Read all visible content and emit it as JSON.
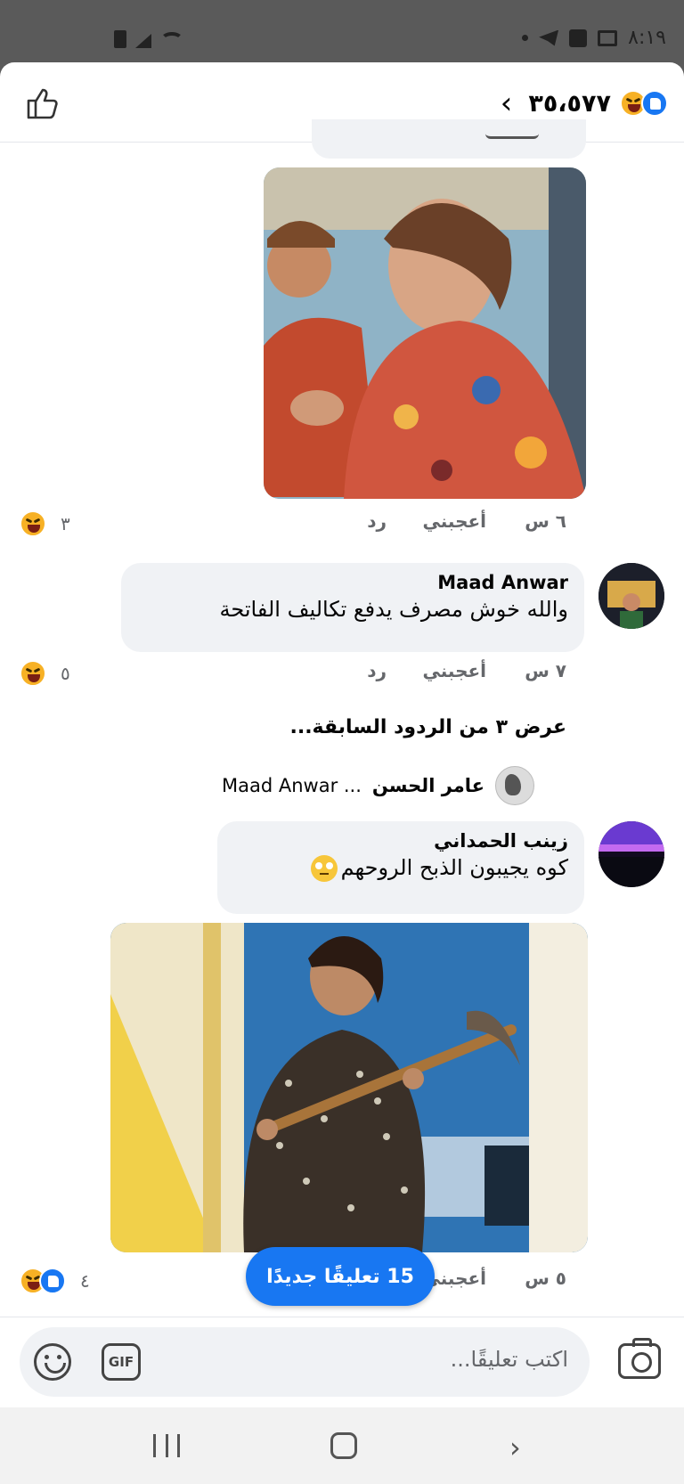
{
  "status_bar": {
    "time": "٨:١٩"
  },
  "header": {
    "reaction_count": "٣٥،٥٧٧",
    "reaction_icons": [
      "like-reaction-icon",
      "haha-reaction-icon"
    ],
    "back_icon": "chevron-left-icon",
    "like_icon": "thumbs-up-outline-icon"
  },
  "comments": [
    {
      "type": "image-reply",
      "time": "٦ س",
      "like_label": "أعجبني",
      "reply_label": "رد",
      "reaction_count": "٣"
    },
    {
      "author": "Maad Anwar",
      "text": "والله خوش مصرف يدفع تكاليف الفاتحة",
      "time": "٧ س",
      "like_label": "أعجبني",
      "reply_label": "رد",
      "reaction_count": "٥"
    },
    {
      "author": "زينب الحمداني",
      "text": "كوه يجيبون الذبح الروحهم",
      "time": "٥ س",
      "like_label": "أعجبني",
      "reaction_count": "٤"
    }
  ],
  "view_previous": "عرض ٣ من الردود السابقة...",
  "reply_preview": {
    "author": "عامر الحسن",
    "text": "Maad Anwar ..."
  },
  "new_comments_pill": "15 تعليقًا جديدًا",
  "composer": {
    "placeholder": "اكتب تعليقًا...",
    "gif_label": "GIF"
  },
  "colors": {
    "accent": "#1877f2",
    "bubble": "#f0f2f5",
    "meta_text": "#65676b"
  }
}
